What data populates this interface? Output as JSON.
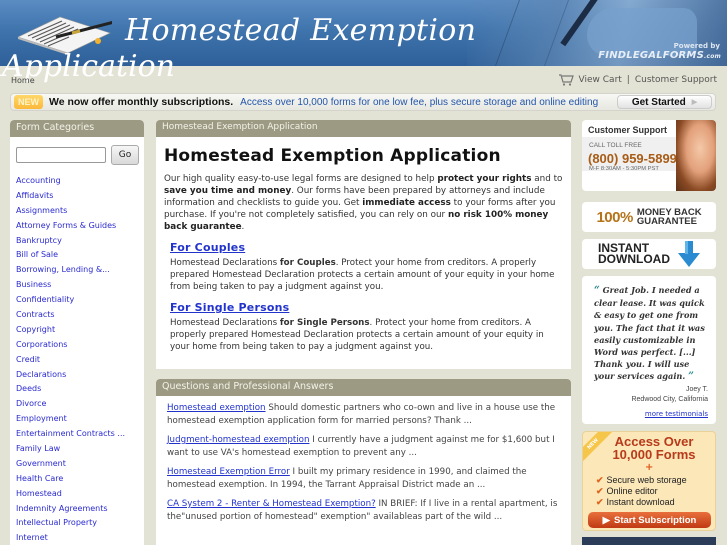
{
  "header": {
    "title_line1": "Homestead Exemption",
    "title_line2": "Application",
    "powered_by": "Powered by",
    "brand": "FINDLEGALFORMS",
    "brand_suffix": ".com"
  },
  "nav": {
    "home": "Home",
    "view_cart": "View Cart",
    "separator": "|",
    "customer_support": "Customer Support"
  },
  "promo": {
    "badge": "NEW",
    "headline": "We now offer monthly subscriptions.",
    "subtext": "Access over 10,000 forms for one low fee, plus secure storage and online editing",
    "button": "Get Started"
  },
  "sidebar": {
    "title": "Form Categories",
    "search_value": "",
    "go_label": "Go",
    "categories": [
      "Accounting",
      "Affidavits",
      "Assignments",
      "Attorney Forms & Guides",
      "Bankruptcy",
      "Bill of Sale",
      "Borrowing, Lending &...",
      "Business",
      "Confidentiality",
      "Contracts",
      "Copyright",
      "Corporations",
      "Credit",
      "Declarations",
      "Deeds",
      "Divorce",
      "Employment",
      "Entertainment Contracts ...",
      "Family Law",
      "Government",
      "Health Care",
      "Homestead",
      "Indemnity Agreements",
      "Intellectual Property",
      "Internet"
    ]
  },
  "main": {
    "panel_title": "Homestead Exemption Application",
    "page_title": "Homestead Exemption Application",
    "intro": {
      "p1": "Our high quality easy-to-use legal forms are designed to help ",
      "b1": "protect your rights",
      "p2": " and to ",
      "b2": "save you time and money",
      "p3": ". Our forms have been prepared by attorneys and include information and checklists to guide you. Get ",
      "b3": "immediate access",
      "p4": " to your forms after you purchase. If you're not completely satisfied, you can rely on our ",
      "b4": "no risk 100% money back guarantee",
      "p5": "."
    },
    "sections": [
      {
        "title": "For Couples",
        "pre": "Homestead Declarations ",
        "bold": "for Couples",
        "post": ". Protect your home from creditors. A properly prepared Homestead Declaration protects a certain amount of your equity in your home from being taken to pay a judgment against you."
      },
      {
        "title": "For Single Persons",
        "pre": "Homestead Declarations ",
        "bold": "for Single Persons",
        "post": ". Protect your home from creditors. A properly prepared Homestead Declaration protects a certain amount of your equity in your home from being taken to pay a judgment against you."
      }
    ],
    "qa_title": "Questions and Professional Answers",
    "qa": [
      {
        "link": "Homestead exemption",
        "text": " Should domestic partners who co-own and live in a house use the homestead exemption application form for married persons? Thank ..."
      },
      {
        "link": "Judgment-homestead exemption",
        "text": " I currently have a judgment against me for $1,600 but I want to use VA's homestead exemption to prevent any ..."
      },
      {
        "link": "Homestead Exemption Error",
        "text": " I built my primary residence in 1990, and claimed the homestead exemption. In 1994, the Tarrant Appraisal District made an ..."
      },
      {
        "link": "CA System 2 - Renter & Homestead Exemption?",
        "text": " IN BRIEF: If I live in a rental apartment, is the\"unused portion of homestead\" exemption\" availableas part of the wild ..."
      }
    ]
  },
  "right": {
    "support_title": "Customer Support",
    "call_label": "CALL TOLL FREE",
    "phone": "(800) 959-5899",
    "hours": "M-F 8:30AM - 5:30PM PST",
    "money_pct": "100%",
    "money_line1": "MONEY BACK",
    "money_line2": "GUARANTEE",
    "instant_line1": "INSTANT",
    "instant_line2": "DOWNLOAD",
    "testimonial": "Great Job. I needed a clear lease. It was quick & easy to get one from you. The fact that it was easily customizable in Word was perfect. [...] Thank you. I will use your services again.",
    "author": "Joey T.",
    "location": "Redwood City, California",
    "more_testimonials": "more testimonials",
    "sub_ribbon": "NEW",
    "sub_head1": "Access Over",
    "sub_head2": "10,000 Forms",
    "sub_plus": "+",
    "sub_features": [
      "Secure web storage",
      "Online editor",
      "Instant download"
    ],
    "sub_button": "Start Subscription"
  },
  "colors": {
    "page_bg": "#e3e3d5",
    "panel_header": "#9c9a83",
    "link": "#1a22cc",
    "phone": "#a85c16",
    "subscribe_button": "#c03a14"
  }
}
